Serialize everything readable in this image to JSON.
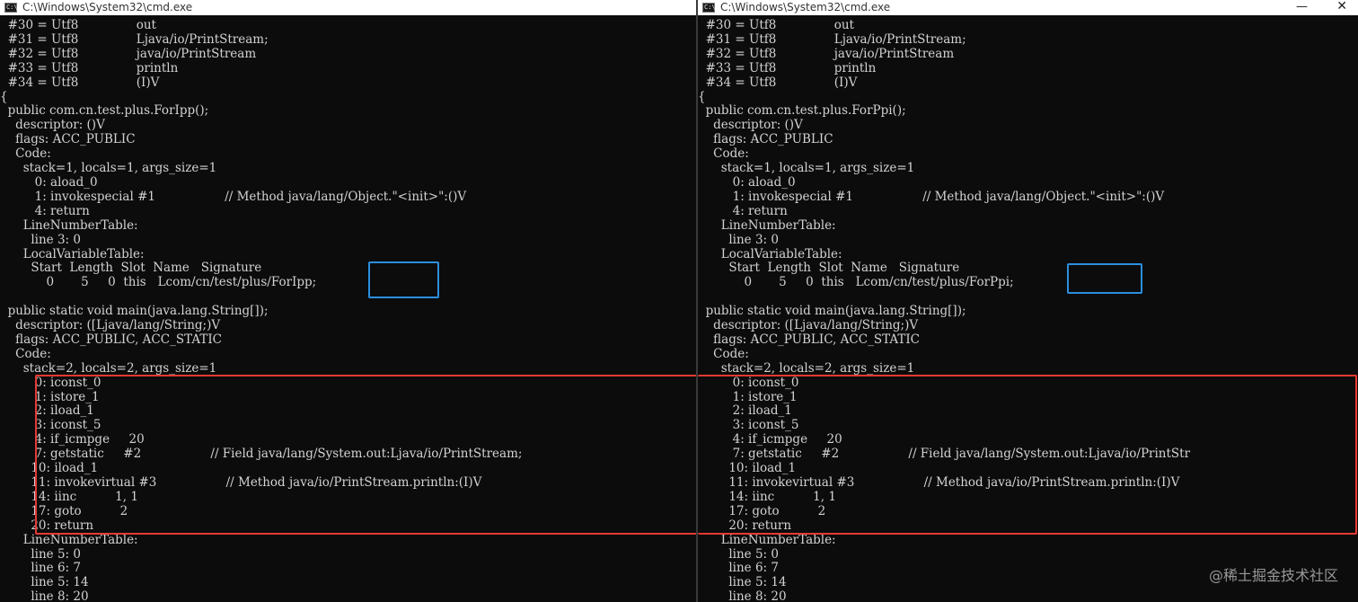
{
  "left_window": {
    "title": "C:\\Windows\\System32\\cmd.exe",
    "icon": "cmd-icon",
    "lines": [
      "  #30 = Utf8               out",
      "  #31 = Utf8               Ljava/io/PrintStream;",
      "  #32 = Utf8               java/io/PrintStream",
      "  #33 = Utf8               println",
      "  #34 = Utf8               (I)V",
      "{",
      "  public com.cn.test.plus.ForIpp();",
      "    descriptor: ()V",
      "    flags: ACC_PUBLIC",
      "    Code:",
      "      stack=1, locals=1, args_size=1",
      "         0: aload_0",
      "         1: invokespecial #1                  // Method java/lang/Object.\"<init>\":()V",
      "         4: return",
      "      LineNumberTable:",
      "        line 3: 0",
      "      LocalVariableTable:",
      "        Start  Length  Slot  Name   Signature",
      "            0       5     0  this   Lcom/cn/test/plus/ForIpp;",
      "",
      "  public static void main(java.lang.String[]);",
      "    descriptor: ([Ljava/lang/String;)V",
      "    flags: ACC_PUBLIC, ACC_STATIC",
      "    Code:",
      "      stack=2, locals=2, args_size=1",
      "         0: iconst_0",
      "         1: istore_1",
      "         2: iload_1",
      "         3: iconst_5",
      "         4: if_icmpge     20",
      "         7: getstatic     #2                  // Field java/lang/System.out:Ljava/io/PrintStream;",
      "        10: iload_1",
      "        11: invokevirtual #3                  // Method java/io/PrintStream.println:(I)V",
      "        14: iinc          1, 1",
      "        17: goto          2",
      "        20: return",
      "      LineNumberTable:",
      "        line 5: 0",
      "        line 6: 7",
      "        line 5: 14",
      "        line 8: 20"
    ]
  },
  "right_window": {
    "title": "C:\\Windows\\System32\\cmd.exe",
    "icon": "cmd-icon",
    "minimize_glyph": "—",
    "close_glyph": "✕",
    "lines": [
      "  #30 = Utf8               out",
      "  #31 = Utf8               Ljava/io/PrintStream;",
      "  #32 = Utf8               java/io/PrintStream",
      "  #33 = Utf8               println",
      "  #34 = Utf8               (I)V",
      "{",
      "  public com.cn.test.plus.ForPpi();",
      "    descriptor: ()V",
      "    flags: ACC_PUBLIC",
      "    Code:",
      "      stack=1, locals=1, args_size=1",
      "         0: aload_0",
      "         1: invokespecial #1                  // Method java/lang/Object.\"<init>\":()V",
      "         4: return",
      "      LineNumberTable:",
      "        line 3: 0",
      "      LocalVariableTable:",
      "        Start  Length  Slot  Name   Signature",
      "            0       5     0  this   Lcom/cn/test/plus/ForPpi;",
      "",
      "  public static void main(java.lang.String[]);",
      "    descriptor: ([Ljava/lang/String;)V",
      "    flags: ACC_PUBLIC, ACC_STATIC",
      "    Code:",
      "      stack=2, locals=2, args_size=1",
      "         0: iconst_0",
      "         1: istore_1",
      "         2: iload_1",
      "         3: iconst_5",
      "         4: if_icmpge     20",
      "         7: getstatic     #2                  // Field java/lang/System.out:Ljava/io/PrintStr",
      "        10: iload_1",
      "        11: invokevirtual #3                  // Method java/io/PrintStream.println:(I)V",
      "        14: iinc          1, 1",
      "        17: goto          2",
      "        20: return",
      "      LineNumberTable:",
      "        line 5: 0",
      "        line 6: 7",
      "        line 5: 14",
      "        line 8: 20"
    ]
  },
  "annotations": {
    "blue_box_color": "#2c8fde",
    "red_box_color": "#e53a33"
  },
  "watermark": "@稀土掘金技术社区"
}
